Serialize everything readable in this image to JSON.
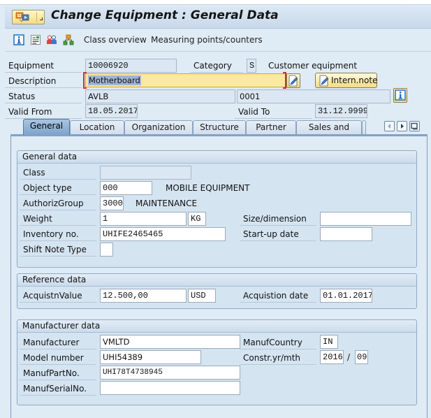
{
  "window": {
    "title": "Change Equipment : General Data"
  },
  "toolbar": {
    "icons": [
      "info-icon",
      "document-icon",
      "partners-icon",
      "hierarchy-icon"
    ],
    "class_overview": "Class overview",
    "measuring_points": "Measuring points/counters"
  },
  "header": {
    "equipment_label": "Equipment",
    "equipment_value": "10006920",
    "category_label": "Category",
    "category_value": "S",
    "category_text": "Customer equipment",
    "description_label": "Description",
    "description_value": "Motherboard",
    "intern_note_label": "Intern.note",
    "status_label": "Status",
    "status_value": "AVLB",
    "status_value2": "0001",
    "valid_from_label": "Valid From",
    "valid_from_value": "18.05.2017",
    "valid_to_label": "Valid To",
    "valid_to_value": "31.12.9999"
  },
  "tabs": [
    {
      "label": "General",
      "active": true
    },
    {
      "label": "Location",
      "active": false
    },
    {
      "label": "Organization",
      "active": false
    },
    {
      "label": "Structure",
      "active": false
    },
    {
      "label": "Partner",
      "active": false
    },
    {
      "label": "Sales and Distr...",
      "active": false
    }
  ],
  "general_data": {
    "title": "General data",
    "class_label": "Class",
    "class_value": "",
    "object_type_label": "Object type",
    "object_type_value": "000",
    "object_type_text": "MOBILE EQUIPMENT",
    "authoriz_group_label": "AuthorizGroup",
    "authoriz_group_value": "3000",
    "authoriz_group_text": "MAINTENANCE",
    "weight_label": "Weight",
    "weight_value": "1",
    "weight_unit": "KG",
    "size_label": "Size/dimension",
    "size_value": "",
    "inventory_label": "Inventory no.",
    "inventory_value": "UHIFE2465465",
    "startup_label": "Start-up date",
    "startup_value": "",
    "shift_note_label": "Shift Note Type",
    "shift_note_value": ""
  },
  "reference_data": {
    "title": "Reference data",
    "acq_value_label": "AcquistnValue",
    "acq_value": "12.500,00",
    "acq_currency": "USD",
    "acq_date_label": "Acquistion date",
    "acq_date": "01.01.2017"
  },
  "manufacturer_data": {
    "title": "Manufacturer data",
    "manufacturer_label": "Manufacturer",
    "manufacturer_value": "VMLTD",
    "country_label": "ManufCountry",
    "country_value": "IN",
    "model_label": "Model number",
    "model_value": "UHI54389",
    "constr_label": "Constr.yr/mth",
    "constr_year": "2016",
    "constr_sep": "/",
    "constr_month": "09",
    "part_label": "ManufPartNo.",
    "part_value": "UHI78T4738945",
    "serial_label": "ManufSerialNo.",
    "serial_value": ""
  }
}
